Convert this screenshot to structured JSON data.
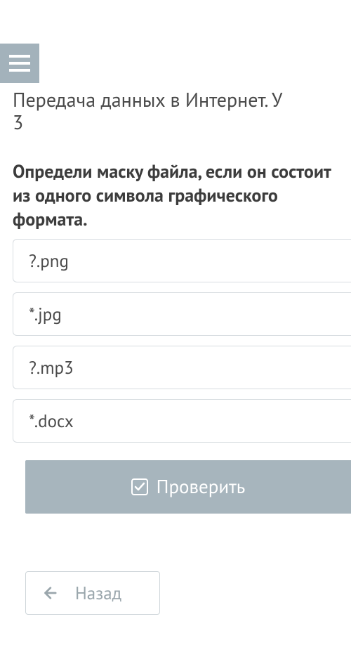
{
  "header": {
    "title_line1": "Передача данных в Интернет. У",
    "title_line2": "3"
  },
  "question": {
    "text": "Определи маску файла, если он состоит из одного символа графического формата."
  },
  "options": [
    {
      "label": "?.png"
    },
    {
      "label": "*.jpg"
    },
    {
      "label": "?.mp3"
    },
    {
      "label": "*.docx"
    }
  ],
  "buttons": {
    "check": "Проверить",
    "back": "Назад"
  }
}
